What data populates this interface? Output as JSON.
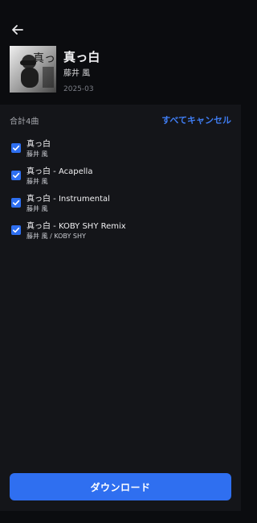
{
  "album": {
    "title": "真っ白",
    "artist": "藤井 風",
    "date": "2025-03",
    "cover_text": "真っ白"
  },
  "list": {
    "summary": "合計4曲",
    "cancel_all": "すべてキャンセル"
  },
  "tracks": [
    {
      "title": "真っ白",
      "artist": "藤井 風",
      "checked": true
    },
    {
      "title": "真っ白 - Acapella",
      "artist": "藤井 風",
      "checked": true
    },
    {
      "title": "真っ白 - Instrumental",
      "artist": "藤井 風",
      "checked": true
    },
    {
      "title": "真っ白 - KOBY SHY Remix",
      "artist": "藤井 風 / KOBY SHY",
      "checked": true
    }
  ],
  "actions": {
    "download_label": "ダウンロード"
  },
  "colors": {
    "accent": "#2f6ff0",
    "link": "#3f7df3",
    "background_top": "#0b0c0f",
    "background_body": "#141519"
  },
  "icons": {
    "back": "arrow-left-icon",
    "check": "checkbox-checked-icon"
  }
}
